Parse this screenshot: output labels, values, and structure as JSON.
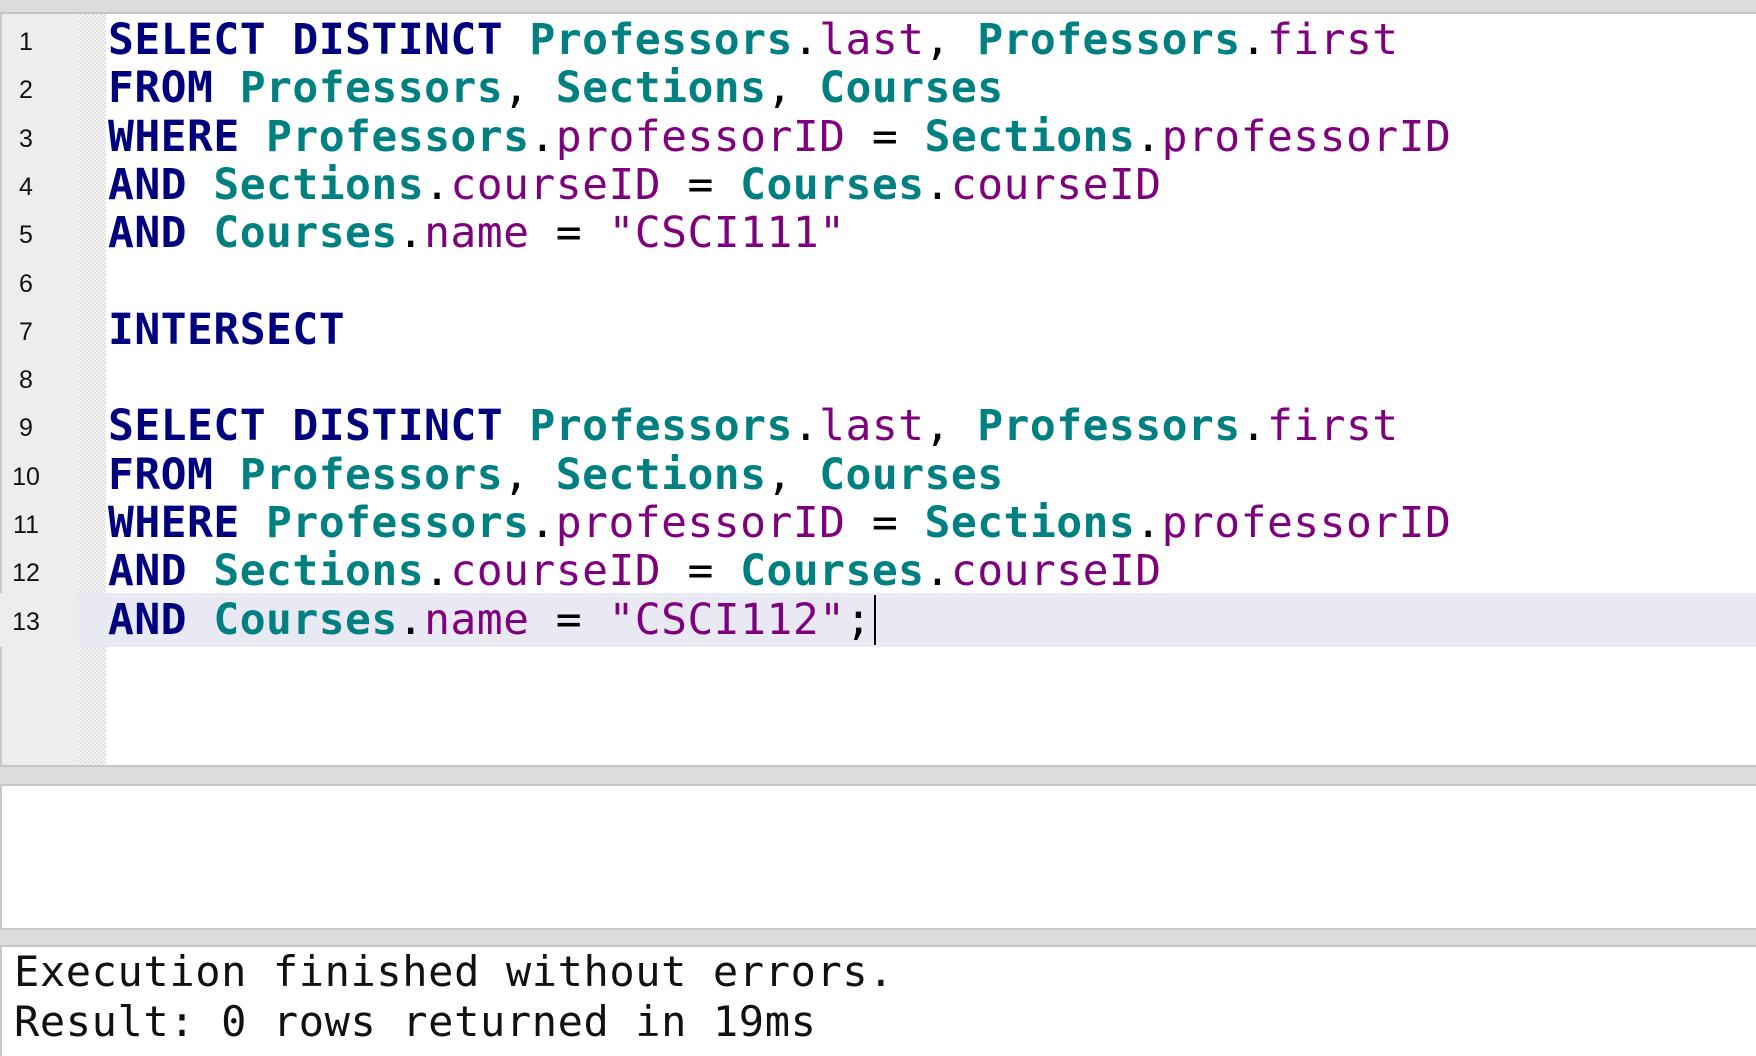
{
  "editor": {
    "current_line": 13,
    "lines": [
      {
        "number": "1",
        "tokens": [
          {
            "t": "keyword",
            "v": "SELECT DISTINCT"
          },
          {
            "t": "space",
            "v": " "
          },
          {
            "t": "table",
            "v": "Professors"
          },
          {
            "t": "punct",
            "v": "."
          },
          {
            "t": "column",
            "v": "last"
          },
          {
            "t": "punct",
            "v": ", "
          },
          {
            "t": "table",
            "v": "Professors"
          },
          {
            "t": "punct",
            "v": "."
          },
          {
            "t": "column",
            "v": "first"
          }
        ]
      },
      {
        "number": "2",
        "tokens": [
          {
            "t": "keyword",
            "v": "FROM"
          },
          {
            "t": "space",
            "v": " "
          },
          {
            "t": "table",
            "v": "Professors"
          },
          {
            "t": "punct",
            "v": ", "
          },
          {
            "t": "table",
            "v": "Sections"
          },
          {
            "t": "punct",
            "v": ", "
          },
          {
            "t": "table",
            "v": "Courses"
          }
        ]
      },
      {
        "number": "3",
        "tokens": [
          {
            "t": "keyword",
            "v": "WHERE"
          },
          {
            "t": "space",
            "v": " "
          },
          {
            "t": "table",
            "v": "Professors"
          },
          {
            "t": "punct",
            "v": "."
          },
          {
            "t": "column",
            "v": "professorID"
          },
          {
            "t": "punct",
            "v": " = "
          },
          {
            "t": "table",
            "v": "Sections"
          },
          {
            "t": "punct",
            "v": "."
          },
          {
            "t": "column",
            "v": "professorID"
          }
        ]
      },
      {
        "number": "4",
        "tokens": [
          {
            "t": "keyword",
            "v": "AND"
          },
          {
            "t": "space",
            "v": " "
          },
          {
            "t": "table",
            "v": "Sections"
          },
          {
            "t": "punct",
            "v": "."
          },
          {
            "t": "column",
            "v": "courseID"
          },
          {
            "t": "punct",
            "v": " = "
          },
          {
            "t": "table",
            "v": "Courses"
          },
          {
            "t": "punct",
            "v": "."
          },
          {
            "t": "column",
            "v": "courseID"
          }
        ]
      },
      {
        "number": "5",
        "tokens": [
          {
            "t": "keyword",
            "v": "AND"
          },
          {
            "t": "space",
            "v": " "
          },
          {
            "t": "table",
            "v": "Courses"
          },
          {
            "t": "punct",
            "v": "."
          },
          {
            "t": "column",
            "v": "name"
          },
          {
            "t": "punct",
            "v": " = "
          },
          {
            "t": "string",
            "v": "\"CSCI111\""
          }
        ]
      },
      {
        "number": "6",
        "tokens": []
      },
      {
        "number": "7",
        "tokens": [
          {
            "t": "keyword",
            "v": "INTERSECT"
          }
        ]
      },
      {
        "number": "8",
        "tokens": []
      },
      {
        "number": "9",
        "tokens": [
          {
            "t": "keyword",
            "v": "SELECT DISTINCT"
          },
          {
            "t": "space",
            "v": " "
          },
          {
            "t": "table",
            "v": "Professors"
          },
          {
            "t": "punct",
            "v": "."
          },
          {
            "t": "column",
            "v": "last"
          },
          {
            "t": "punct",
            "v": ", "
          },
          {
            "t": "table",
            "v": "Professors"
          },
          {
            "t": "punct",
            "v": "."
          },
          {
            "t": "column",
            "v": "first"
          }
        ]
      },
      {
        "number": "10",
        "tokens": [
          {
            "t": "keyword",
            "v": "FROM"
          },
          {
            "t": "space",
            "v": " "
          },
          {
            "t": "table",
            "v": "Professors"
          },
          {
            "t": "punct",
            "v": ", "
          },
          {
            "t": "table",
            "v": "Sections"
          },
          {
            "t": "punct",
            "v": ", "
          },
          {
            "t": "table",
            "v": "Courses"
          }
        ]
      },
      {
        "number": "11",
        "tokens": [
          {
            "t": "keyword",
            "v": "WHERE"
          },
          {
            "t": "space",
            "v": " "
          },
          {
            "t": "table",
            "v": "Professors"
          },
          {
            "t": "punct",
            "v": "."
          },
          {
            "t": "column",
            "v": "professorID"
          },
          {
            "t": "punct",
            "v": " = "
          },
          {
            "t": "table",
            "v": "Sections"
          },
          {
            "t": "punct",
            "v": "."
          },
          {
            "t": "column",
            "v": "professorID"
          }
        ]
      },
      {
        "number": "12",
        "tokens": [
          {
            "t": "keyword",
            "v": "AND"
          },
          {
            "t": "space",
            "v": " "
          },
          {
            "t": "table",
            "v": "Sections"
          },
          {
            "t": "punct",
            "v": "."
          },
          {
            "t": "column",
            "v": "courseID"
          },
          {
            "t": "punct",
            "v": " = "
          },
          {
            "t": "table",
            "v": "Courses"
          },
          {
            "t": "punct",
            "v": "."
          },
          {
            "t": "column",
            "v": "courseID"
          }
        ]
      },
      {
        "number": "13",
        "tokens": [
          {
            "t": "keyword",
            "v": "AND"
          },
          {
            "t": "space",
            "v": " "
          },
          {
            "t": "table",
            "v": "Courses"
          },
          {
            "t": "punct",
            "v": "."
          },
          {
            "t": "column",
            "v": "name"
          },
          {
            "t": "punct",
            "v": " = "
          },
          {
            "t": "string",
            "v": "\"CSCI112\""
          },
          {
            "t": "punct",
            "v": ";"
          }
        ]
      }
    ]
  },
  "messages": {
    "line1": "Execution finished without errors.",
    "line2": "Result: 0 rows returned in 19ms"
  },
  "colors": {
    "keyword": "#00007f",
    "table": "#008080",
    "column": "#7f007f",
    "string": "#7f007f",
    "current_line_highlight": "#e9e9f4"
  }
}
